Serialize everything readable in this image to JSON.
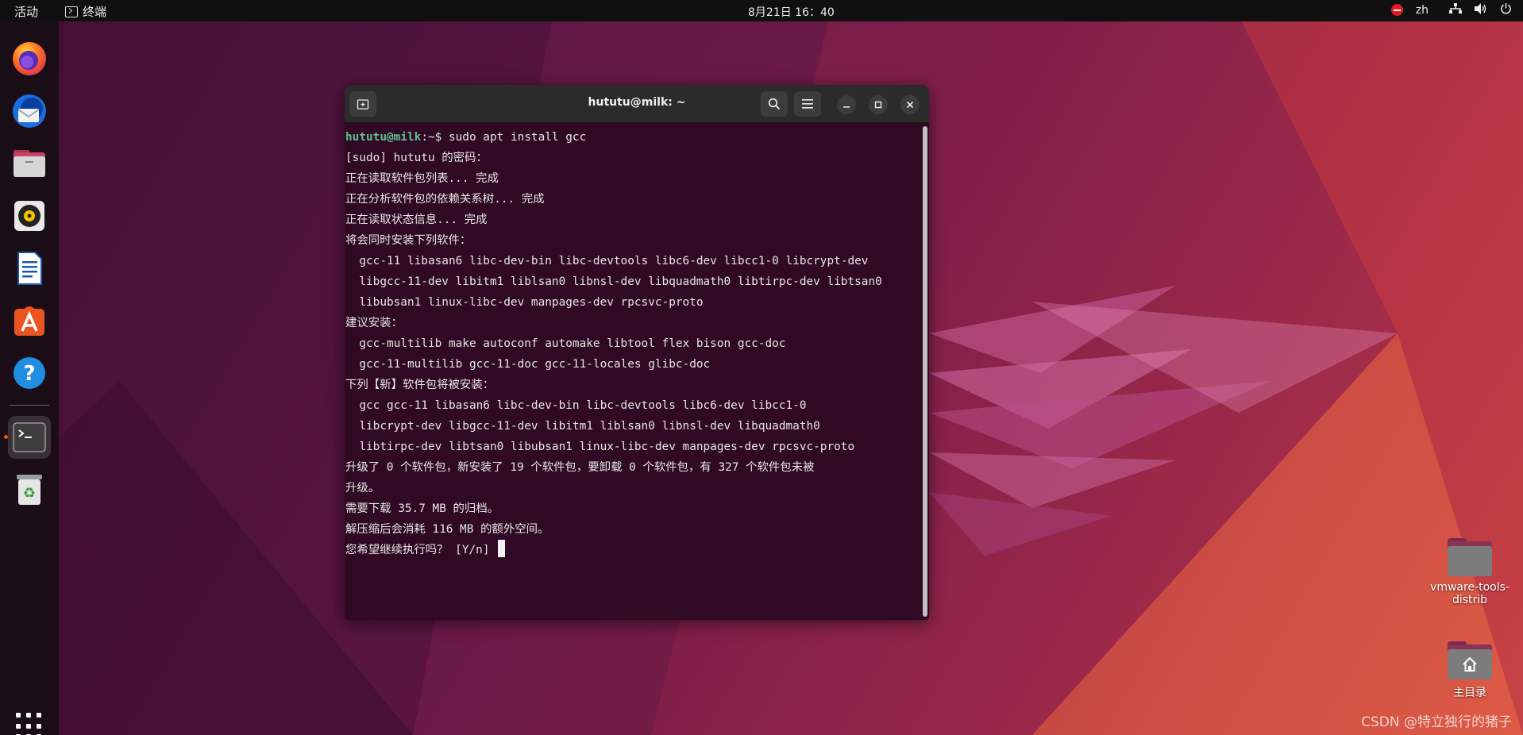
{
  "topbar": {
    "activities": "活动",
    "app_name": "终端",
    "clock": "8月21日  16：40",
    "lang": "zh"
  },
  "dock": {
    "items": [
      {
        "name": "firefox",
        "icon": "firefox-icon"
      },
      {
        "name": "thunderbird",
        "icon": "thunderbird-icon"
      },
      {
        "name": "files",
        "icon": "files-icon"
      },
      {
        "name": "rhythmbox",
        "icon": "rhythmbox-icon"
      },
      {
        "name": "writer",
        "icon": "writer-icon"
      },
      {
        "name": "software",
        "icon": "app-center-icon"
      },
      {
        "name": "help",
        "icon": "help-icon"
      },
      {
        "name": "terminal",
        "icon": "terminal-icon"
      },
      {
        "name": "trash",
        "icon": "trash-icon"
      }
    ]
  },
  "terminal": {
    "title": "hututu@milk: ~",
    "prompt_user": "hututu@milk",
    "prompt_rest": ":~$ sudo apt install gcc",
    "lines": [
      "[sudo] hututu 的密码：",
      "正在读取软件包列表... 完成",
      "正在分析软件包的依赖关系树... 完成",
      "正在读取状态信息... 完成",
      "将会同时安装下列软件：",
      "  gcc-11 libasan6 libc-dev-bin libc-devtools libc6-dev libcc1-0 libcrypt-dev",
      "  libgcc-11-dev libitm1 liblsan0 libnsl-dev libquadmath0 libtirpc-dev libtsan0",
      "  libubsan1 linux-libc-dev manpages-dev rpcsvc-proto",
      "建议安装：",
      "  gcc-multilib make autoconf automake libtool flex bison gcc-doc",
      "  gcc-11-multilib gcc-11-doc gcc-11-locales glibc-doc",
      "下列【新】软件包将被安装：",
      "  gcc gcc-11 libasan6 libc-dev-bin libc-devtools libc6-dev libcc1-0",
      "  libcrypt-dev libgcc-11-dev libitm1 liblsan0 libnsl-dev libquadmath0",
      "  libtirpc-dev libtsan0 libubsan1 linux-libc-dev manpages-dev rpcsvc-proto",
      "升级了 0 个软件包，新安装了 19 个软件包，要卸载 0 个软件包，有 327 个软件包未被",
      "升级。",
      "需要下载 35.7 MB 的归档。",
      "解压缩后会消耗 116 MB 的额外空间。"
    ],
    "final_prompt": "您希望继续执行吗？ [Y/n] "
  },
  "desktop": {
    "icons": [
      {
        "label": "vmware-tools-\ndistrib",
        "icon": "folder-icon"
      },
      {
        "label": "主目录",
        "icon": "home-folder-icon"
      }
    ]
  },
  "watermark": "CSDN @特立独行的猪子"
}
